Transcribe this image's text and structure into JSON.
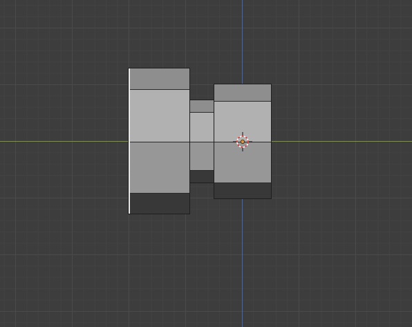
{
  "viewport": {
    "background": "#3d3d3d",
    "grid_color": "#4a4a4a",
    "x_axis_color": "#7a9a2e",
    "z_axis_color": "#3f67b5"
  },
  "objects": [
    {
      "name": "left-block"
    },
    {
      "name": "middle-connector"
    },
    {
      "name": "right-block"
    }
  ],
  "cursor": {
    "icon": "3d-cursor-icon",
    "ring_colors": [
      "#ffffff",
      "#d6322f"
    ]
  }
}
